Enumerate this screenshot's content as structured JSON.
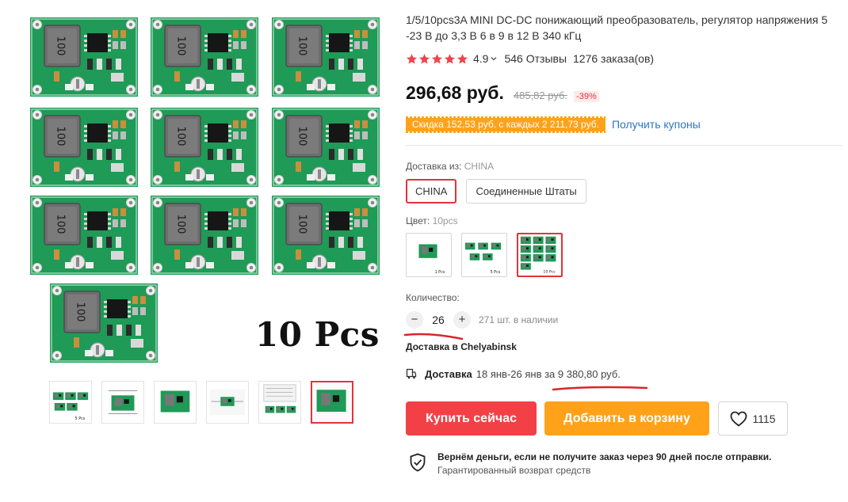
{
  "gallery": {
    "main_label": "10 Pcs",
    "main_chip_text": "100",
    "thumbs": [
      {
        "name": "thumb-5pcs",
        "caption": "5 Pcs"
      },
      {
        "name": "thumb-dimensions",
        "caption": ""
      },
      {
        "name": "thumb-single-board",
        "caption": ""
      },
      {
        "name": "thumb-wiring-diagram",
        "caption": ""
      },
      {
        "name": "thumb-spec-sheet",
        "caption": ""
      },
      {
        "name": "thumb-board-angle",
        "caption": ""
      }
    ],
    "active_thumb_index": 5
  },
  "product": {
    "title": "1/5/10pcs3A MINI DC-DC понижающий преобразователь, регулятор напряжения 5 -23 В до 3,3 В 6 в 9 в 12 В 340 кГц",
    "rating": "4.9",
    "stars": 5,
    "reviews": "546 Отзывы",
    "orders": "1276 заказа(ов)",
    "price": "296,68 руб.",
    "old_price": "485,82 руб.",
    "discount": "-39%",
    "coupon_text": "Скидка 152,53 руб. с каждых 2 211,73 руб.",
    "coupon_link": "Получить купоны"
  },
  "shipping_from": {
    "label": "Доставка из:",
    "selected": "CHINA",
    "options": [
      "CHINA",
      "Соединенные Штаты"
    ]
  },
  "color": {
    "label": "Цвет:",
    "selected": "10pcs",
    "options": [
      {
        "caption": "1 Pcs"
      },
      {
        "caption": "5 Pcs"
      },
      {
        "caption": "10 Pcs"
      }
    ],
    "selected_index": 2
  },
  "quantity": {
    "label": "Количество:",
    "value": "26",
    "minus": "−",
    "plus": "+",
    "stock": "271 шт. в наличии"
  },
  "delivery": {
    "to": "Доставка в Chelyabinsk",
    "label": "Доставка",
    "dates": "18 янв-26 янв за 9 380,80 руб."
  },
  "actions": {
    "buy": "Купить сейчас",
    "cart": "Добавить в корзину",
    "wishlist_count": "1115"
  },
  "guarantee": {
    "title": "Вернём деньги, если не получите заказ через 90 дней после отправки.",
    "subtitle": "Гарантированный возврат средств"
  },
  "colors": {
    "accent_red": "#e2343a",
    "buy_red": "#f34046",
    "orange": "#ffa21a",
    "link_blue": "#2e74c8",
    "pcb_green": "#1f9a57",
    "annotation_red": "#d9262c"
  }
}
